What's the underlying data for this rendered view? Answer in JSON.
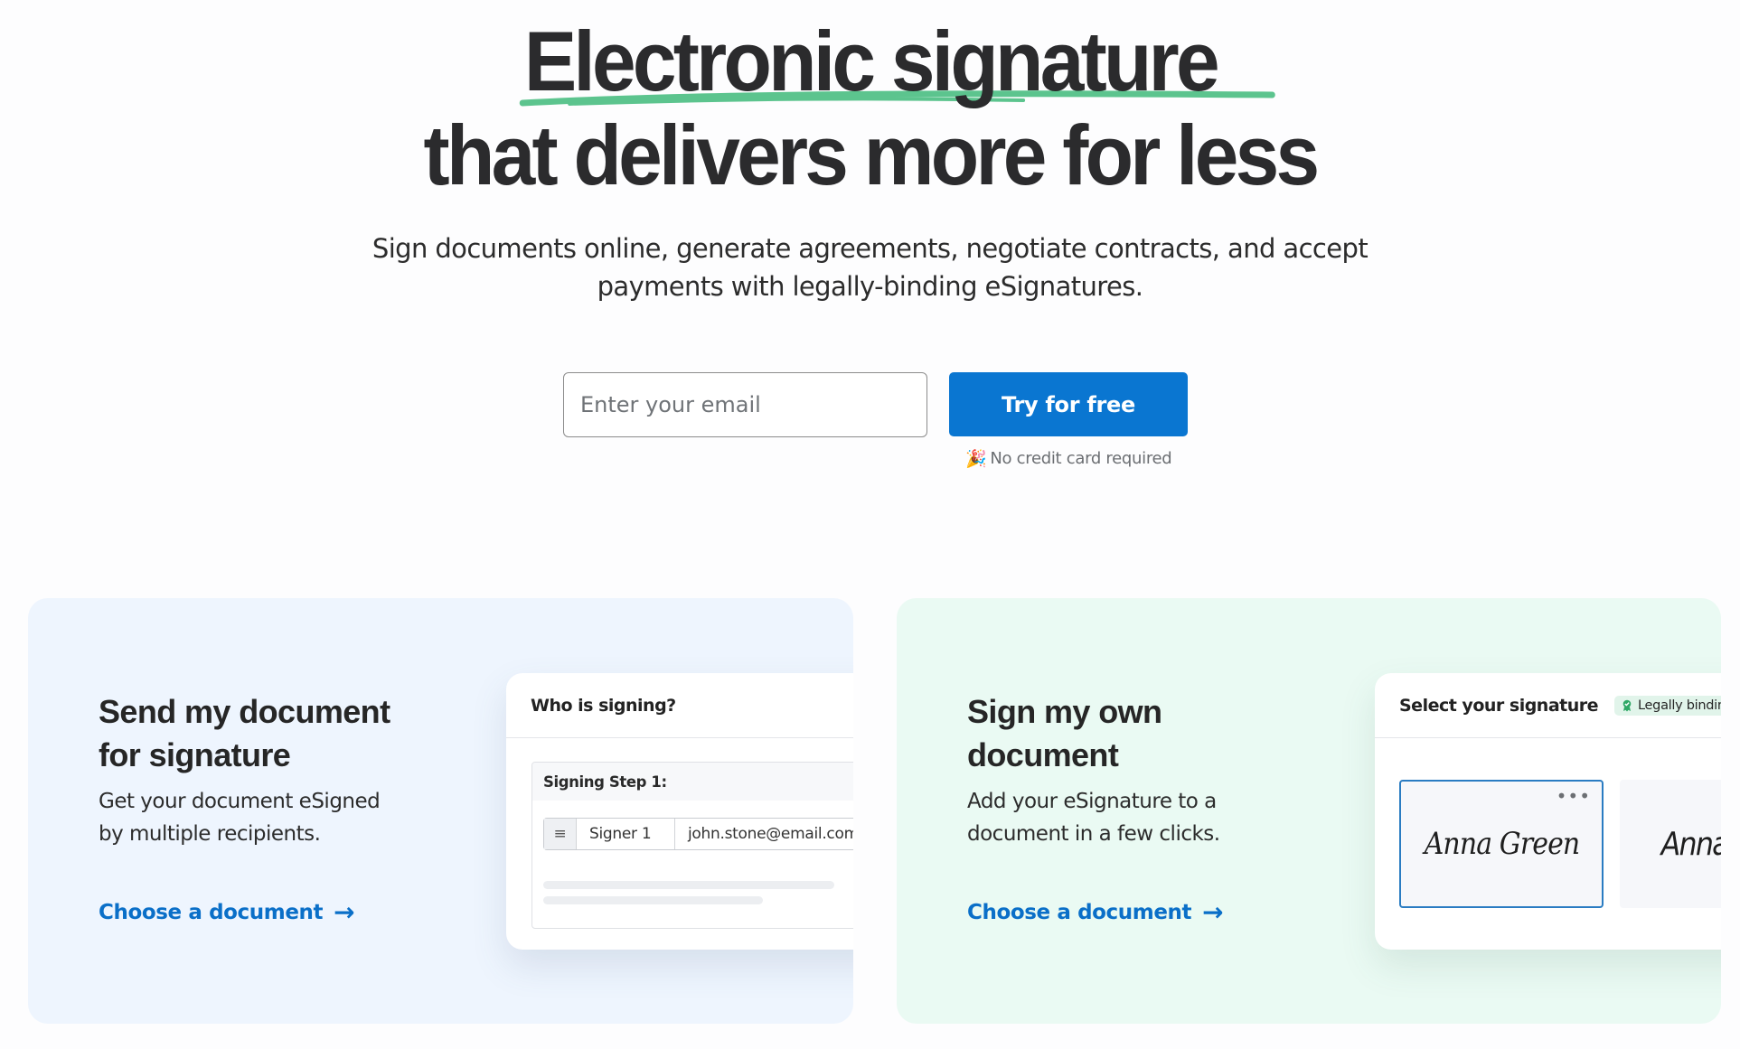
{
  "hero": {
    "title_line1": "Electronic signature",
    "title_line2": "that delivers more for less",
    "subtitle_line1": "Sign documents online, generate agreements, negotiate contracts, and accept",
    "subtitle_line2": "payments with legally-binding eSignatures.",
    "email_placeholder": "Enter your email",
    "email_value": "",
    "cta_label": "Try for free",
    "note_icon": "🎉",
    "note_text": "No credit card required"
  },
  "colors": {
    "accent_blue": "#0a76d1",
    "link_blue": "#0a6fc8",
    "scribble_green": "#5cc48e",
    "card_send_bg": "#eef5fe",
    "card_sign_bg": "#eafaf3"
  },
  "cards": [
    {
      "title_line1": "Send my document",
      "title_line2": "for signature",
      "desc_line1": "Get your document eSigned",
      "desc_line2": "by multiple recipients.",
      "link_label": "Choose a document",
      "link_icon": "→",
      "mock": {
        "header": "Who is signing?",
        "step_label": "Signing Step 1:",
        "handle_icon": "≡",
        "signer_name": "Signer 1",
        "signer_email": "john.stone@email.com"
      }
    },
    {
      "title_line1": "Sign my own",
      "title_line2": "document",
      "desc_line1": "Add your eSignature to a",
      "desc_line2": "document in a few clicks.",
      "link_label": "Choose a document",
      "link_icon": "→",
      "mock": {
        "header": "Select your signature",
        "badge": "Legally binding",
        "more_icon": "•••",
        "signatures": [
          "Anna Green",
          "Anna Green"
        ]
      }
    }
  ]
}
